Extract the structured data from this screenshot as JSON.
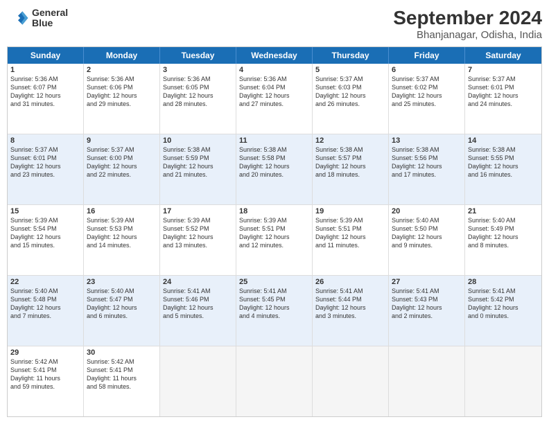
{
  "header": {
    "logo_line1": "General",
    "logo_line2": "Blue",
    "month": "September 2024",
    "location": "Bhanjanagar, Odisha, India"
  },
  "days": [
    "Sunday",
    "Monday",
    "Tuesday",
    "Wednesday",
    "Thursday",
    "Friday",
    "Saturday"
  ],
  "rows": [
    {
      "alt": false,
      "cells": [
        {
          "day": "1",
          "text": "Sunrise: 5:36 AM\nSunset: 6:07 PM\nDaylight: 12 hours\nand 31 minutes."
        },
        {
          "day": "2",
          "text": "Sunrise: 5:36 AM\nSunset: 6:06 PM\nDaylight: 12 hours\nand 29 minutes."
        },
        {
          "day": "3",
          "text": "Sunrise: 5:36 AM\nSunset: 6:05 PM\nDaylight: 12 hours\nand 28 minutes."
        },
        {
          "day": "4",
          "text": "Sunrise: 5:36 AM\nSunset: 6:04 PM\nDaylight: 12 hours\nand 27 minutes."
        },
        {
          "day": "5",
          "text": "Sunrise: 5:37 AM\nSunset: 6:03 PM\nDaylight: 12 hours\nand 26 minutes."
        },
        {
          "day": "6",
          "text": "Sunrise: 5:37 AM\nSunset: 6:02 PM\nDaylight: 12 hours\nand 25 minutes."
        },
        {
          "day": "7",
          "text": "Sunrise: 5:37 AM\nSunset: 6:01 PM\nDaylight: 12 hours\nand 24 minutes."
        }
      ]
    },
    {
      "alt": true,
      "cells": [
        {
          "day": "8",
          "text": "Sunrise: 5:37 AM\nSunset: 6:01 PM\nDaylight: 12 hours\nand 23 minutes."
        },
        {
          "day": "9",
          "text": "Sunrise: 5:37 AM\nSunset: 6:00 PM\nDaylight: 12 hours\nand 22 minutes."
        },
        {
          "day": "10",
          "text": "Sunrise: 5:38 AM\nSunset: 5:59 PM\nDaylight: 12 hours\nand 21 minutes."
        },
        {
          "day": "11",
          "text": "Sunrise: 5:38 AM\nSunset: 5:58 PM\nDaylight: 12 hours\nand 20 minutes."
        },
        {
          "day": "12",
          "text": "Sunrise: 5:38 AM\nSunset: 5:57 PM\nDaylight: 12 hours\nand 18 minutes."
        },
        {
          "day": "13",
          "text": "Sunrise: 5:38 AM\nSunset: 5:56 PM\nDaylight: 12 hours\nand 17 minutes."
        },
        {
          "day": "14",
          "text": "Sunrise: 5:38 AM\nSunset: 5:55 PM\nDaylight: 12 hours\nand 16 minutes."
        }
      ]
    },
    {
      "alt": false,
      "cells": [
        {
          "day": "15",
          "text": "Sunrise: 5:39 AM\nSunset: 5:54 PM\nDaylight: 12 hours\nand 15 minutes."
        },
        {
          "day": "16",
          "text": "Sunrise: 5:39 AM\nSunset: 5:53 PM\nDaylight: 12 hours\nand 14 minutes."
        },
        {
          "day": "17",
          "text": "Sunrise: 5:39 AM\nSunset: 5:52 PM\nDaylight: 12 hours\nand 13 minutes."
        },
        {
          "day": "18",
          "text": "Sunrise: 5:39 AM\nSunset: 5:51 PM\nDaylight: 12 hours\nand 12 minutes."
        },
        {
          "day": "19",
          "text": "Sunrise: 5:39 AM\nSunset: 5:51 PM\nDaylight: 12 hours\nand 11 minutes."
        },
        {
          "day": "20",
          "text": "Sunrise: 5:40 AM\nSunset: 5:50 PM\nDaylight: 12 hours\nand 9 minutes."
        },
        {
          "day": "21",
          "text": "Sunrise: 5:40 AM\nSunset: 5:49 PM\nDaylight: 12 hours\nand 8 minutes."
        }
      ]
    },
    {
      "alt": true,
      "cells": [
        {
          "day": "22",
          "text": "Sunrise: 5:40 AM\nSunset: 5:48 PM\nDaylight: 12 hours\nand 7 minutes."
        },
        {
          "day": "23",
          "text": "Sunrise: 5:40 AM\nSunset: 5:47 PM\nDaylight: 12 hours\nand 6 minutes."
        },
        {
          "day": "24",
          "text": "Sunrise: 5:41 AM\nSunset: 5:46 PM\nDaylight: 12 hours\nand 5 minutes."
        },
        {
          "day": "25",
          "text": "Sunrise: 5:41 AM\nSunset: 5:45 PM\nDaylight: 12 hours\nand 4 minutes."
        },
        {
          "day": "26",
          "text": "Sunrise: 5:41 AM\nSunset: 5:44 PM\nDaylight: 12 hours\nand 3 minutes."
        },
        {
          "day": "27",
          "text": "Sunrise: 5:41 AM\nSunset: 5:43 PM\nDaylight: 12 hours\nand 2 minutes."
        },
        {
          "day": "28",
          "text": "Sunrise: 5:41 AM\nSunset: 5:42 PM\nDaylight: 12 hours\nand 0 minutes."
        }
      ]
    },
    {
      "alt": false,
      "cells": [
        {
          "day": "29",
          "text": "Sunrise: 5:42 AM\nSunset: 5:41 PM\nDaylight: 11 hours\nand 59 minutes."
        },
        {
          "day": "30",
          "text": "Sunrise: 5:42 AM\nSunset: 5:41 PM\nDaylight: 11 hours\nand 58 minutes."
        },
        {
          "day": "",
          "text": ""
        },
        {
          "day": "",
          "text": ""
        },
        {
          "day": "",
          "text": ""
        },
        {
          "day": "",
          "text": ""
        },
        {
          "day": "",
          "text": ""
        }
      ]
    }
  ]
}
